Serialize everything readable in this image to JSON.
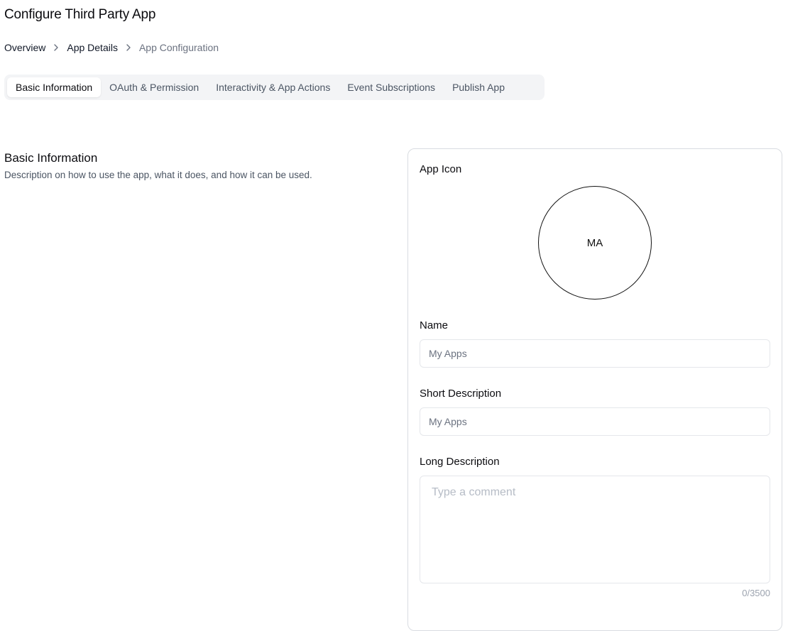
{
  "header": {
    "title": "Configure Third Party App"
  },
  "breadcrumb": {
    "items": [
      "Overview",
      "App Details",
      "App Configuration"
    ],
    "separator_icon": "chevron-right-icon"
  },
  "tabs": [
    {
      "label": "Basic Information",
      "active": true
    },
    {
      "label": "OAuth & Permission",
      "active": false
    },
    {
      "label": "Interactivity & App Actions",
      "active": false
    },
    {
      "label": "Event Subscriptions",
      "active": false
    },
    {
      "label": "Publish App",
      "active": false
    }
  ],
  "section": {
    "title": "Basic Information",
    "description": "Description on how to use the app, what it does, and how it can be used."
  },
  "form": {
    "app_icon_label": "App Icon",
    "app_icon_initials": "MA",
    "name_label": "Name",
    "name_placeholder": "My Apps",
    "short_description_label": "Short Description",
    "short_description_placeholder": "My Apps",
    "long_description_label": "Long Description",
    "long_description_placeholder": "Type a comment",
    "char_count": "0/3500"
  },
  "colors": {
    "tab_bar_bg": "#f3f4f6",
    "muted_text": "#6b7280",
    "border": "#e5e7eb"
  }
}
